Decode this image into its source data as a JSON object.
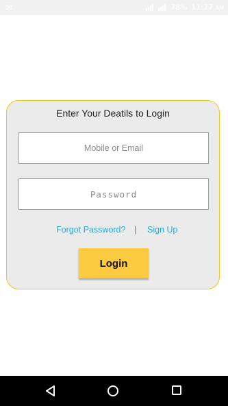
{
  "status_bar": {
    "battery": "78%",
    "time": "11:27",
    "ampm": "AM"
  },
  "login_card": {
    "title": "Enter Your Deatils to Login",
    "mobile_placeholder": "Mobile or Email",
    "password_placeholder": "Password",
    "forgot_label": "Forgot Password?",
    "separator": "|",
    "signup_label": "Sign Up",
    "login_label": "Login"
  },
  "colors": {
    "accent": "#fdcb40",
    "card_border": "#f5c518",
    "link": "#29a8d6"
  },
  "nav_icons": [
    "back-icon",
    "home-icon",
    "recents-icon"
  ]
}
